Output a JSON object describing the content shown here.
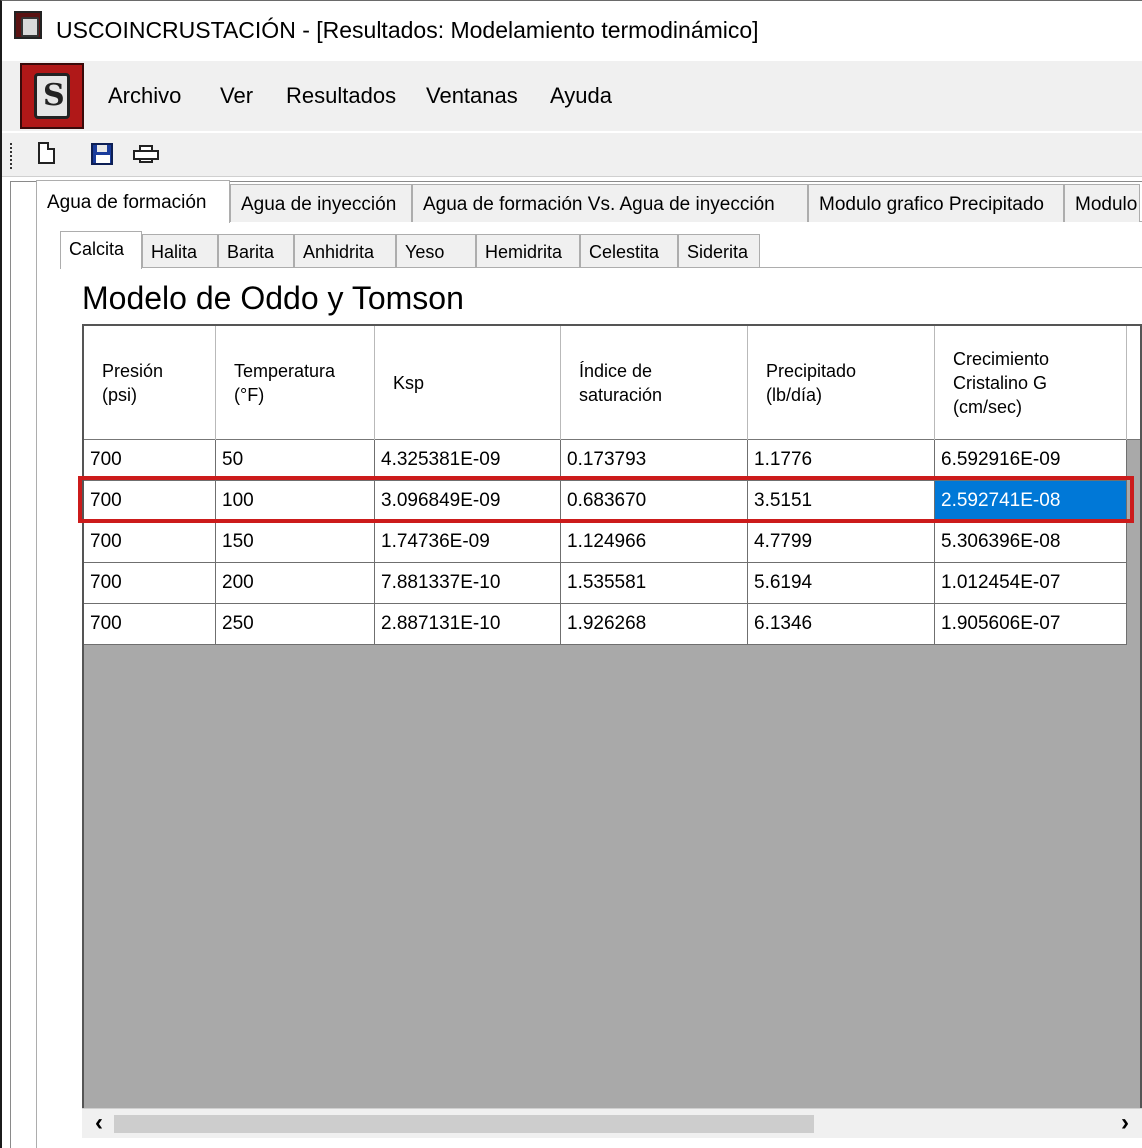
{
  "window": {
    "title": "USCOINCRUSTACIÓN - [Resultados: Modelamiento termodinámico]"
  },
  "menu": {
    "items": [
      "Archivo",
      "Ver",
      "Resultados",
      "Ventanas",
      "Ayuda"
    ]
  },
  "toolbar": {
    "icons": [
      "new-document-icon",
      "save-icon",
      "print-icon"
    ]
  },
  "outer_tabs": [
    "Agua de formación",
    "Agua de inyección",
    "Agua de formación Vs. Agua de inyección",
    "Modulo grafico Precipitado",
    "Modulo"
  ],
  "outer_tab_active": "Agua de formación",
  "inner_tabs": [
    "Calcita",
    "Halita",
    "Barita",
    "Anhidrita",
    "Yeso",
    "Hemidrita",
    "Celestita",
    "Siderita"
  ],
  "inner_tab_active": "Calcita",
  "model_title": "Modelo de Oddo y Tomson",
  "table": {
    "columns": [
      "Presión\n(psi)",
      "Temperatura\n(°F)",
      "Ksp",
      "Índice de\nsaturación",
      "Precipitado\n(lb/día)",
      "Crecimiento\nCristalino G\n(cm/sec)"
    ],
    "rows": [
      [
        "700",
        "50",
        "4.325381E-09",
        "0.173793",
        "1.1776",
        "6.592916E-09"
      ],
      [
        "700",
        "100",
        "3.096849E-09",
        "0.683670",
        "3.5151",
        "2.592741E-08"
      ],
      [
        "700",
        "150",
        "1.74736E-09",
        "1.124966",
        "4.7799",
        "5.306396E-08"
      ],
      [
        "700",
        "200",
        "7.881337E-10",
        "1.535581",
        "5.6194",
        "1.012454E-07"
      ],
      [
        "700",
        "250",
        "2.887131E-10",
        "1.926268",
        "6.1346",
        "1.905606E-07"
      ]
    ],
    "selected_row": 1,
    "selected_col": 5
  },
  "scrollbar": {
    "left_arrow": "‹",
    "right_arrow": "›"
  },
  "colors": {
    "selection": "#0078d7",
    "highlight_border": "#cc1b1b",
    "grid_background": "#a9a9a9"
  }
}
